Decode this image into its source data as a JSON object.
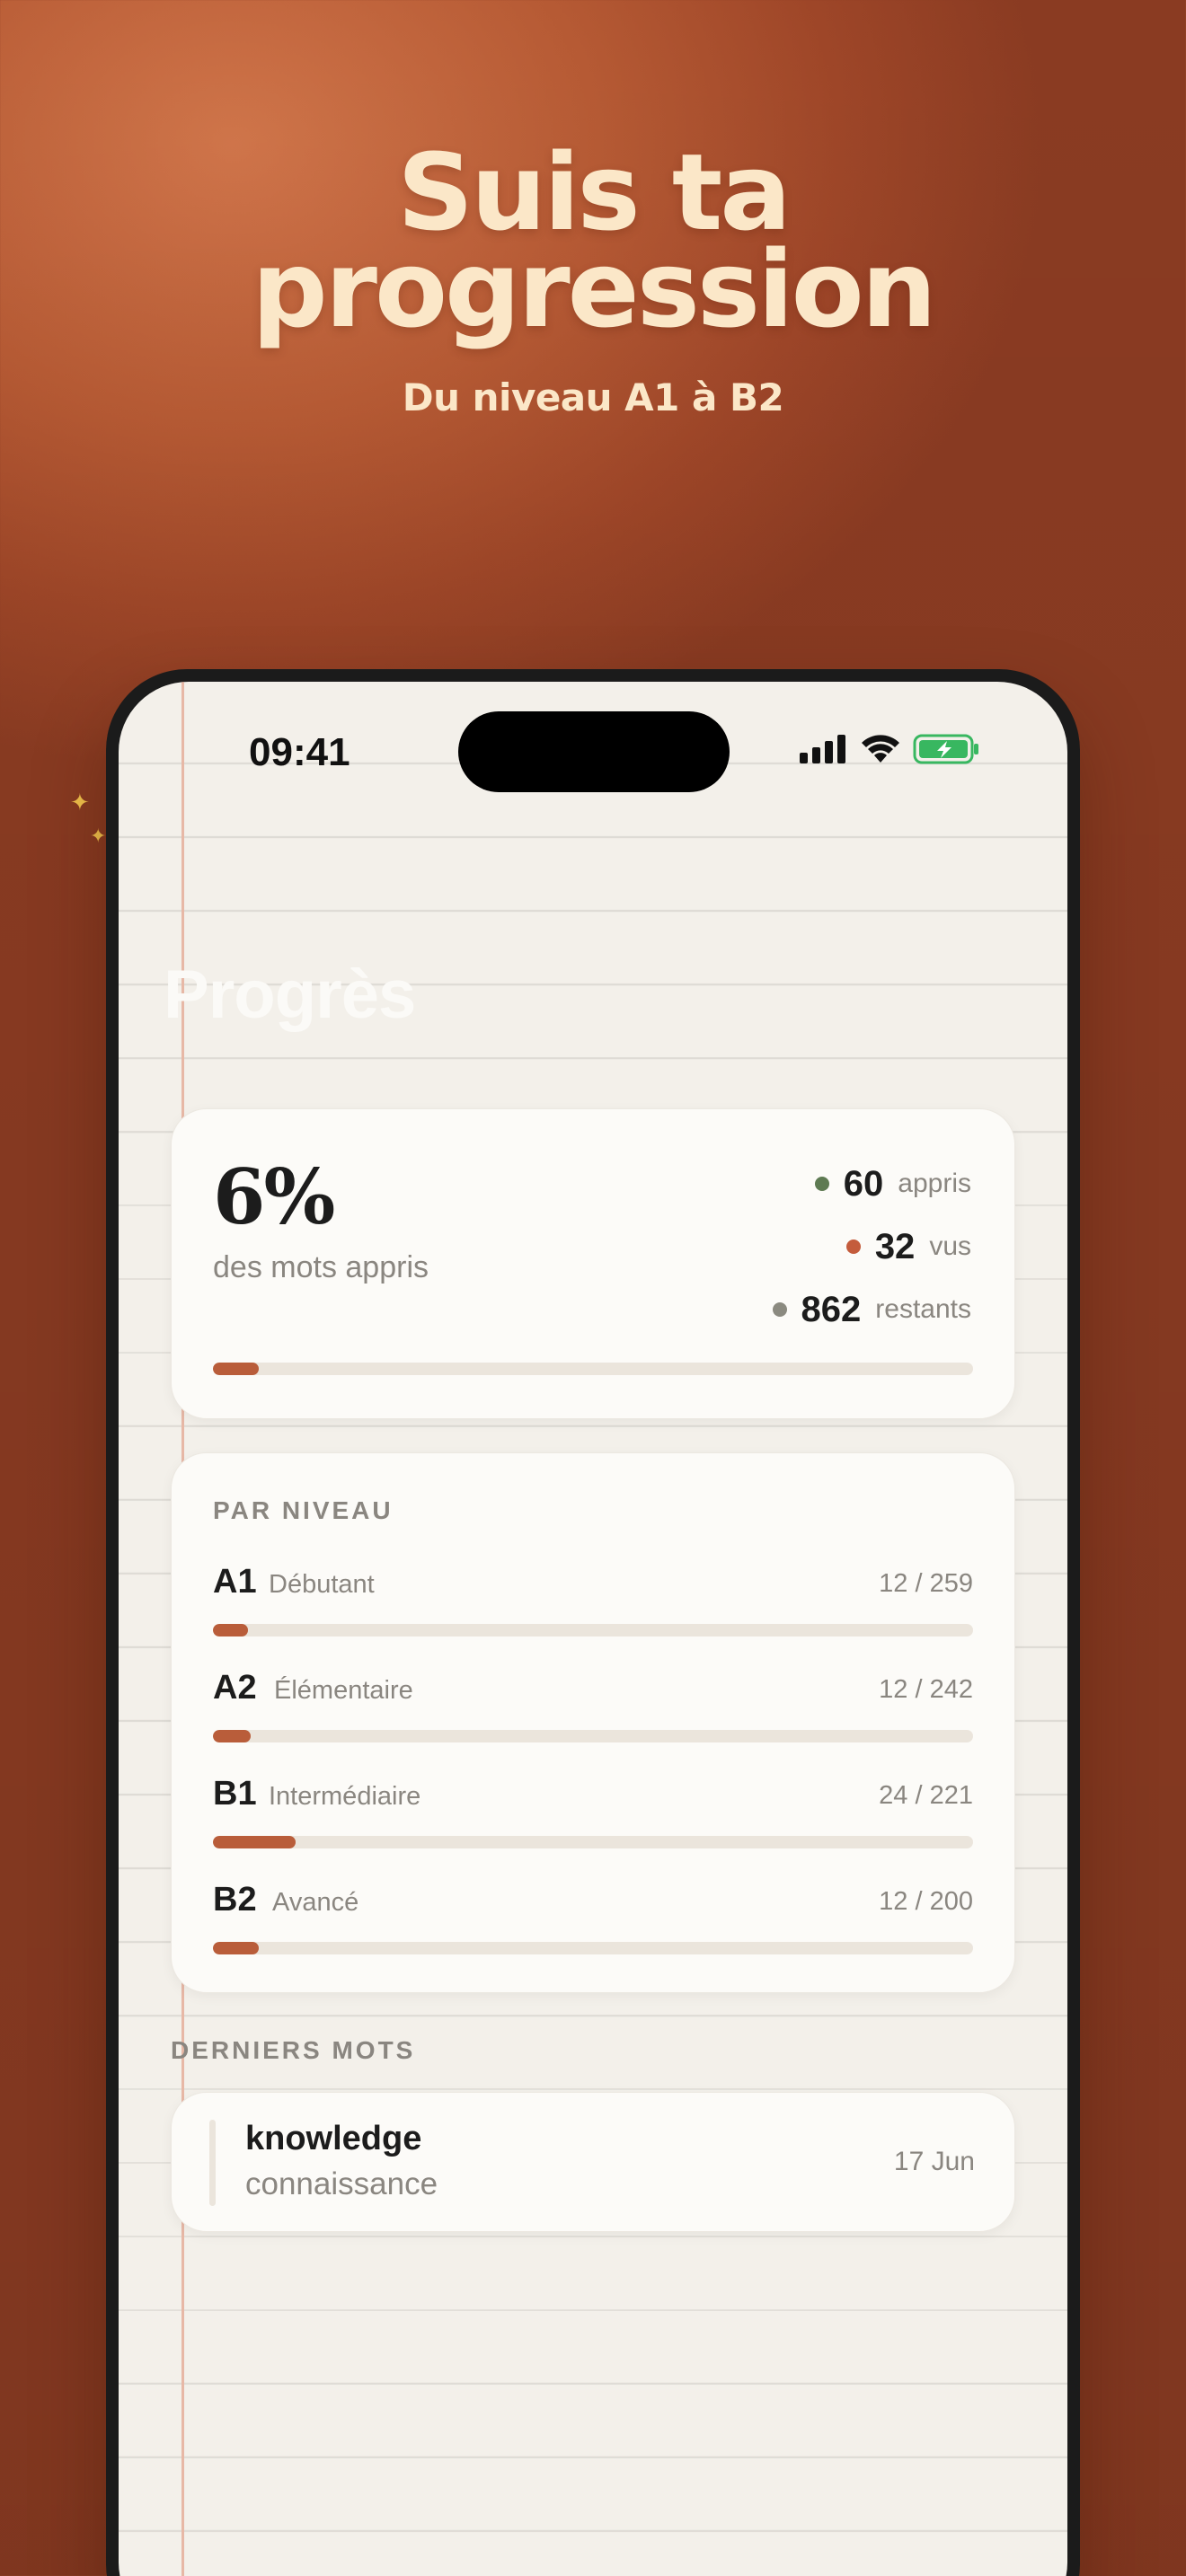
{
  "hero": {
    "title_line1": "Suis ta",
    "title_line2": "progression",
    "subtitle": "Du niveau A1 à B2"
  },
  "status_bar": {
    "time": "09:41",
    "icons": [
      "cellular-signal-icon",
      "wifi-icon",
      "battery-charging-icon"
    ]
  },
  "page": {
    "title": "Progrès"
  },
  "summary": {
    "percent": "6%",
    "caption": "des mots appris",
    "progress_fraction": 0.06,
    "stats": [
      {
        "value": "60",
        "label": "appris",
        "color": "#5e7a52"
      },
      {
        "value": "32",
        "label": "vus",
        "color": "#c45c3c"
      },
      {
        "value": "862",
        "label": "restants",
        "color": "#8b8a80"
      }
    ]
  },
  "levels": {
    "title": "PAR NIVEAU",
    "items": [
      {
        "code": "A1",
        "name": "Débutant",
        "count": "12 / 259",
        "fraction": 0.046
      },
      {
        "code": "A2",
        "name": "Élémentaire",
        "count": "12 / 242",
        "fraction": 0.05
      },
      {
        "code": "B1",
        "name": "Intermédiaire",
        "count": "24 / 221",
        "fraction": 0.109
      },
      {
        "code": "B2",
        "name": "Avancé",
        "count": "12 / 200",
        "fraction": 0.06
      }
    ]
  },
  "recent": {
    "title": "DERNIERS MOTS",
    "items": [
      {
        "word": "knowledge",
        "translation": "connaissance",
        "date": "17 Jun"
      }
    ]
  },
  "colors": {
    "accent": "#b95d3a",
    "background_gradient": [
      "#d0754a",
      "#8a3b22"
    ],
    "headline": "#fbe7c8"
  }
}
